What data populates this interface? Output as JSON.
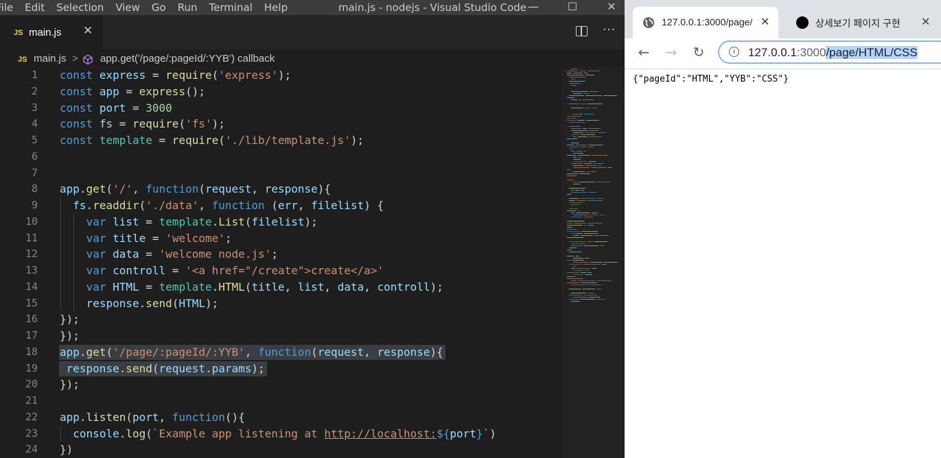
{
  "vscode": {
    "menu": [
      "File",
      "Edit",
      "Selection",
      "View",
      "Go",
      "Run",
      "Terminal",
      "Help"
    ],
    "window_title": "main.js - nodejs - Visual Studio Code",
    "tab": {
      "badge": "JS",
      "filename": "main.js",
      "close": "✕"
    },
    "breadcrumb": {
      "badge": "JS",
      "file": "main.js",
      "separator": ">",
      "symbol": "app.get('/page/:pageId/:YYB') callback"
    },
    "line_numbers": [
      "1",
      "2",
      "3",
      "4",
      "5",
      "6",
      "7",
      "8",
      "9",
      "10",
      "11",
      "12",
      "13",
      "14",
      "15",
      "16",
      "17",
      "18",
      "19",
      "20",
      "21",
      "22",
      "23",
      "24"
    ],
    "code_lines": [
      "const express = require('express');",
      "const app = express();",
      "const port = 3000",
      "const fs = require('fs');",
      "const template = require('./lib/template.js');",
      "",
      "",
      "app.get('/', function(request, response){",
      "  fs.readdir('./data', function (err, filelist) {",
      "    var list = template.List(filelist);",
      "    var title = 'welcome';",
      "    var data = 'welcome node.js';",
      "    var controll = '<a href=\"/create\">create</a>'",
      "    var HTML = template.HTML(title, list, data, controll);",
      "    response.send(HTML);",
      "});",
      "});",
      "app.get('/page/:pageId/:YYB', function(request, response){",
      " response.send(request.params);",
      "});",
      "",
      "app.listen(port, function(){",
      "  console.log(`Example app listening at http://localhost:${port}`)",
      "})"
    ]
  },
  "browser": {
    "tabs": [
      {
        "title": "127.0.0.1:3000/page/",
        "icon": "globe-icon",
        "close": "✕"
      },
      {
        "title": "상세보기 페이지 구현",
        "icon": "circle-icon",
        "close": "✕"
      }
    ],
    "nav": {
      "back": "←",
      "forward": "→",
      "reload": "↻"
    },
    "url": {
      "host": "127.0.0.1",
      "port": ":3000",
      "path": "/page/HTML/CSS"
    },
    "body_text": "{\"pageId\":\"HTML\",\"YYB\":\"CSS\"}"
  },
  "colors": {
    "editor_bg": "#1e1e1e",
    "keyword": "#569cd6",
    "variable": "#9cdcfe",
    "function": "#dcdcaa",
    "string": "#ce9178",
    "number": "#b5cea8",
    "selection": "#3a3d41"
  }
}
